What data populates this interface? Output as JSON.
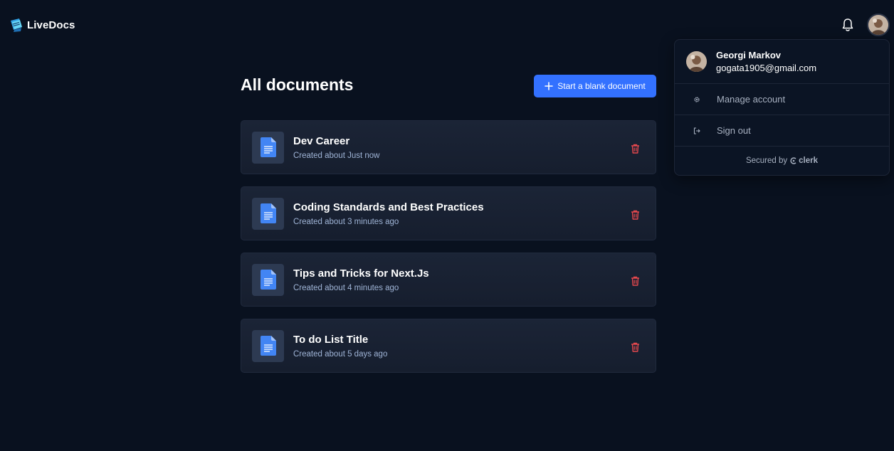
{
  "header": {
    "app_name": "LiveDocs",
    "logo_icon": "livedocs-logo-icon",
    "notification_icon": "bell-icon"
  },
  "main": {
    "title": "All documents",
    "new_document_label": "Start a blank document",
    "documents": [
      {
        "title": "Dev Career",
        "meta": "Created about Just now"
      },
      {
        "title": "Coding Standards and Best Practices",
        "meta": "Created about 3 minutes ago"
      },
      {
        "title": "Tips and Tricks for Next.Js",
        "meta": "Created about 4 minutes ago"
      },
      {
        "title": "To do List Title",
        "meta": "Created about 5 days ago"
      }
    ]
  },
  "user_menu": {
    "name": "Georgi Markov",
    "email": "gogata1905@gmail.com",
    "items": [
      {
        "label": "Manage account",
        "icon": "gear-icon"
      },
      {
        "label": "Sign out",
        "icon": "sign-out-icon"
      }
    ],
    "secured_by": "Secured by",
    "provider": "clerk"
  },
  "colors": {
    "background": "#09111f",
    "accent": "#3371ff",
    "delete": "#e5484d",
    "doc_icon": "#4285f4"
  }
}
